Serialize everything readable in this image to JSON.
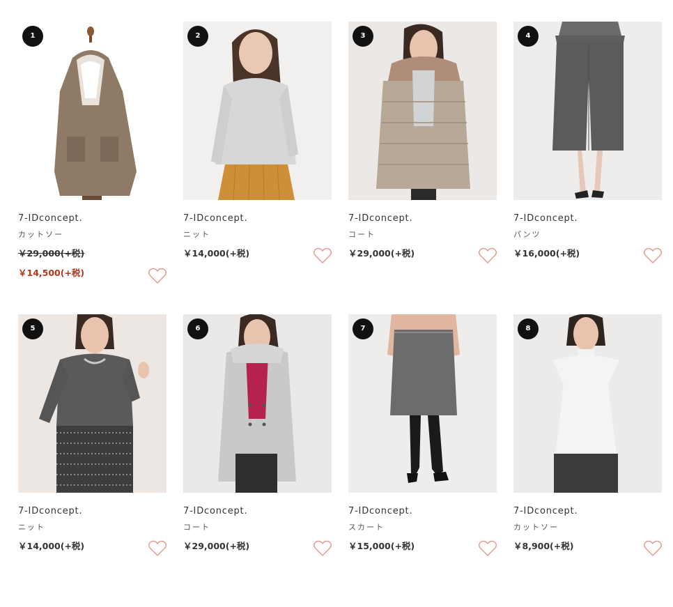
{
  "colors": {
    "accent_sale": "#b23a1e",
    "heart": "#e29b93",
    "badge": "#111111"
  },
  "products": [
    {
      "rank": "1",
      "brand": "7-IDconcept.",
      "category": "カットソー",
      "price": "￥29,000(+税)",
      "sale_price": "￥14,500(+税)",
      "image_icon": "coat-on-mannequin-photo"
    },
    {
      "rank": "2",
      "brand": "7-IDconcept.",
      "category": "ニット",
      "price": "￥14,000(+税)",
      "sale_price": null,
      "image_icon": "gray-knit-photo"
    },
    {
      "rank": "3",
      "brand": "7-IDconcept.",
      "category": "コート",
      "price": "￥29,000(+税)",
      "sale_price": null,
      "image_icon": "down-coat-photo"
    },
    {
      "rank": "4",
      "brand": "7-IDconcept.",
      "category": "パンツ",
      "price": "￥16,000(+税)",
      "sale_price": null,
      "image_icon": "wide-pants-photo"
    },
    {
      "rank": "5",
      "brand": "7-IDconcept.",
      "category": "ニット",
      "price": "￥14,000(+税)",
      "sale_price": null,
      "image_icon": "charcoal-knit-photo"
    },
    {
      "rank": "6",
      "brand": "7-IDconcept.",
      "category": "コート",
      "price": "￥29,000(+税)",
      "sale_price": null,
      "image_icon": "hooded-coat-photo"
    },
    {
      "rank": "7",
      "brand": "7-IDconcept.",
      "category": "スカート",
      "price": "￥15,000(+税)",
      "sale_price": null,
      "image_icon": "gray-skirt-photo"
    },
    {
      "rank": "8",
      "brand": "7-IDconcept.",
      "category": "カットソー",
      "price": "￥8,900(+税)",
      "sale_price": null,
      "image_icon": "white-turtleneck-photo"
    }
  ]
}
